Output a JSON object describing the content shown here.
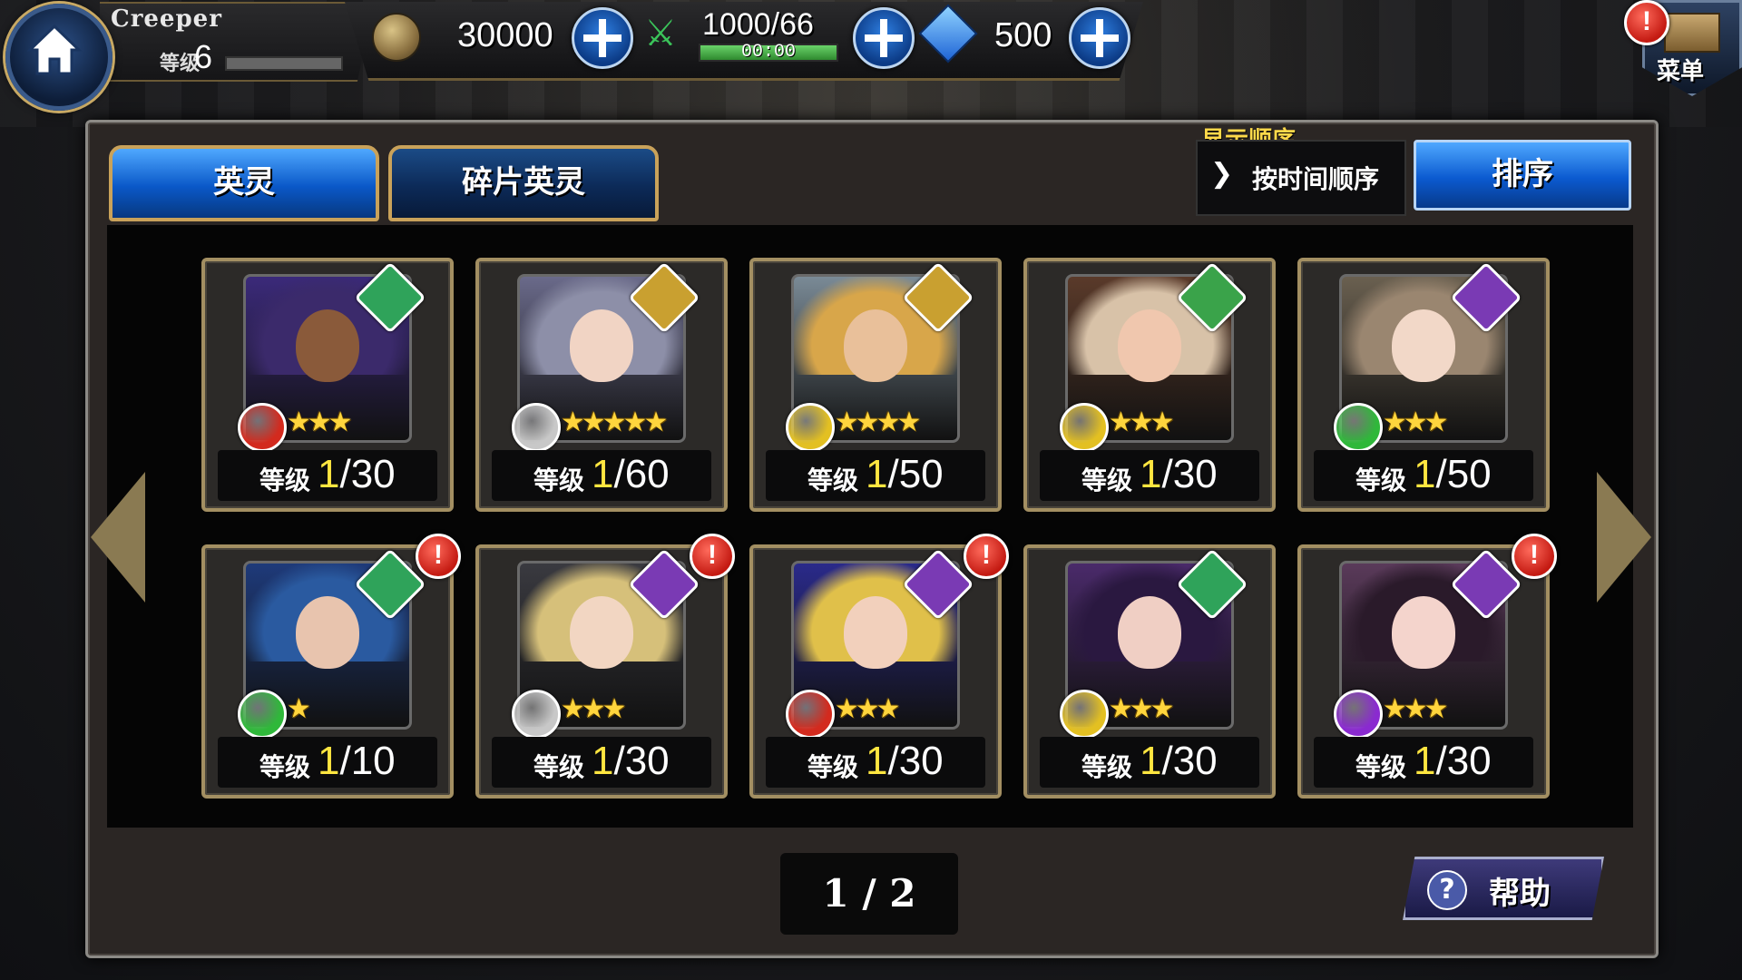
{
  "player": {
    "name": "Creeper",
    "level_label": "等级",
    "level": "6"
  },
  "resources": {
    "coins": "30000",
    "stamina": "1000/66",
    "stamina_timer": "00:00",
    "gems": "500"
  },
  "menu": {
    "label": "菜单"
  },
  "tabs": [
    {
      "label": "英灵",
      "active": true
    },
    {
      "label": "碎片英灵",
      "active": false
    }
  ],
  "sort": {
    "caption": "显示顺序",
    "selected": "按时间顺序",
    "button_label": "排序"
  },
  "level_label": "等级",
  "heroes": [
    {
      "cur": "1",
      "max": "/30",
      "stars": "★★★",
      "class_color": "#2fa35a",
      "element_color": "#d32a1e",
      "hair": "#3b2a6b",
      "skin": "#8a5a3a",
      "bg": "#3b2a7a",
      "alert": false
    },
    {
      "cur": "1",
      "max": "/60",
      "stars": "★★★★★",
      "class_color": "#c9a030",
      "element_color": "#c8c8c8",
      "hair": "#8d8fa8",
      "skin": "#f1d4c4",
      "bg": "#6a6a8a",
      "alert": false
    },
    {
      "cur": "1",
      "max": "/50",
      "stars": "★★★★",
      "class_color": "#c9a030",
      "element_color": "#e3c022",
      "hair": "#d8a64a",
      "skin": "#e9c09a",
      "bg": "#7a8a96",
      "alert": false
    },
    {
      "cur": "1",
      "max": "/30",
      "stars": "★★★",
      "class_color": "#3aa34a",
      "element_color": "#e3c022",
      "hair": "#d8c2a8",
      "skin": "#f0c7ae",
      "bg": "#5a3a2a",
      "alert": false
    },
    {
      "cur": "1",
      "max": "/50",
      "stars": "★★★",
      "class_color": "#7a3ab4",
      "element_color": "#2fb83a",
      "hair": "#9a8670",
      "skin": "#f2d8c8",
      "bg": "#6a6050",
      "alert": false
    },
    {
      "cur": "1",
      "max": "/10",
      "stars": "★",
      "class_color": "#2fa35a",
      "element_color": "#2fb83a",
      "hair": "#2a5aa0",
      "skin": "#e8c4ae",
      "bg": "#1e3a7a",
      "alert": true
    },
    {
      "cur": "1",
      "max": "/30",
      "stars": "★★★",
      "class_color": "#7a3ab4",
      "element_color": "#c8c8c8",
      "hair": "#d6c07a",
      "skin": "#f2d6c2",
      "bg": "#3a3a40",
      "alert": true
    },
    {
      "cur": "1",
      "max": "/30",
      "stars": "★★★",
      "class_color": "#7a3ab4",
      "element_color": "#d32a1e",
      "hair": "#e0c04a",
      "skin": "#f2d0bc",
      "bg": "#2a2a8a",
      "alert": true
    },
    {
      "cur": "1",
      "max": "/30",
      "stars": "★★★",
      "class_color": "#2fa35a",
      "element_color": "#e3c022",
      "hair": "#2a1840",
      "skin": "#f0cfc4",
      "bg": "#4a2a6a",
      "alert": false
    },
    {
      "cur": "1",
      "max": "/30",
      "stars": "★★★",
      "class_color": "#7a3ab4",
      "element_color": "#8a2ad0",
      "hair": "#2a1a2a",
      "skin": "#f4d4cc",
      "bg": "#5a3a5a",
      "alert": true
    }
  ],
  "pager": "1 / 2",
  "help": {
    "label": "帮助",
    "icon": "?"
  },
  "alert_glyph": "!"
}
